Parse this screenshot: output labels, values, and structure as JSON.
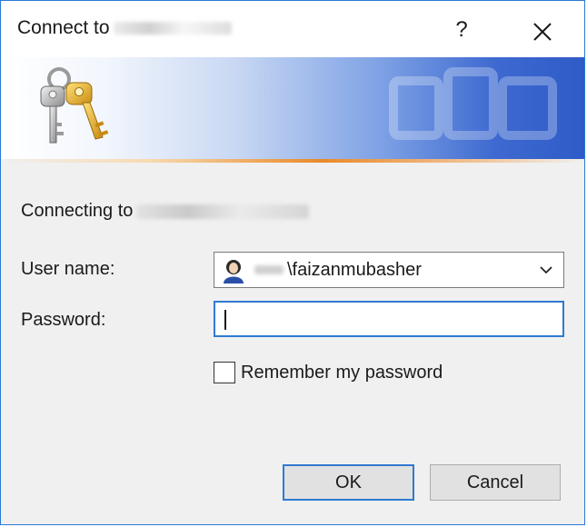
{
  "window": {
    "title_prefix": "Connect to",
    "help_label": "?",
    "close_label": "✕"
  },
  "banner": {
    "icon": "keys-icon",
    "watermark_icon": "keys-watermark-icon"
  },
  "main": {
    "connecting_prefix": "Connecting to"
  },
  "form": {
    "username_label": "User name:",
    "username_value": "\\faizanmubasher",
    "username_avatar_icon": "user-avatar-icon",
    "dropdown_icon": "chevron-down-icon",
    "password_label": "Password:",
    "password_value": "",
    "remember_label": "Remember my password",
    "remember_checked": false
  },
  "buttons": {
    "ok_label": "OK",
    "cancel_label": "Cancel"
  },
  "colors": {
    "accent": "#2f7ad1",
    "banner_blue": "#2f5bc8",
    "banner_orange_line": "#e98a2a"
  }
}
